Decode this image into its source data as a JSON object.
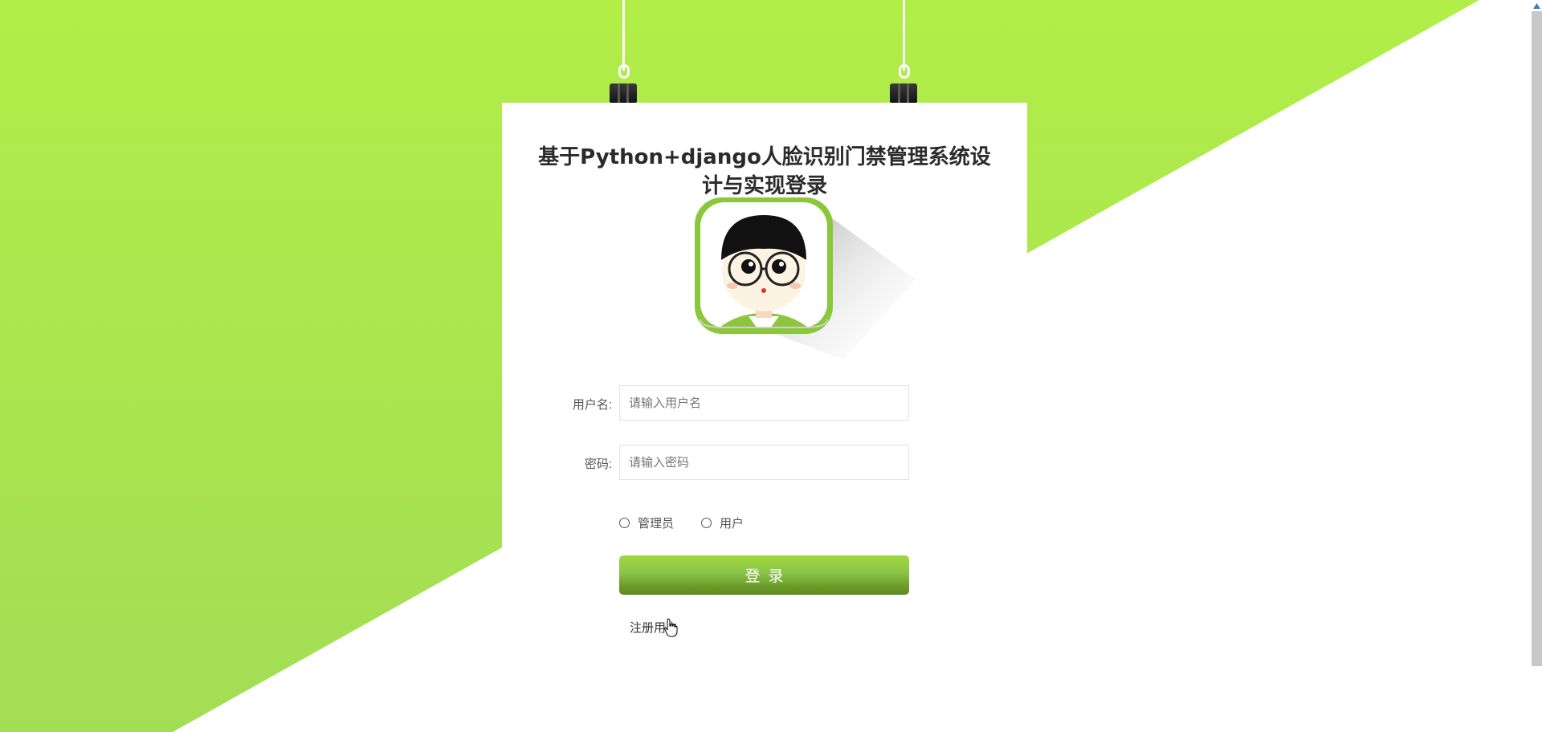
{
  "page": {
    "title": "基于Python+django人脸识别门禁管理系统设计与实现登录"
  },
  "colors": {
    "accent_green": "#b0ed48",
    "button_green": "#8bc34a",
    "background": "#ffffff"
  },
  "avatar": {
    "icon": "cartoon-avatar-icon"
  },
  "form": {
    "username_label": "用户名:",
    "username_placeholder": "请输入用户名",
    "username_value": "",
    "password_label": "密码:",
    "password_placeholder": "请输入密码",
    "password_value": "",
    "roles": [
      {
        "label": "管理员",
        "selected": false
      },
      {
        "label": "用户",
        "selected": false
      }
    ],
    "login_label": "登录",
    "register_label": "注册用户"
  }
}
